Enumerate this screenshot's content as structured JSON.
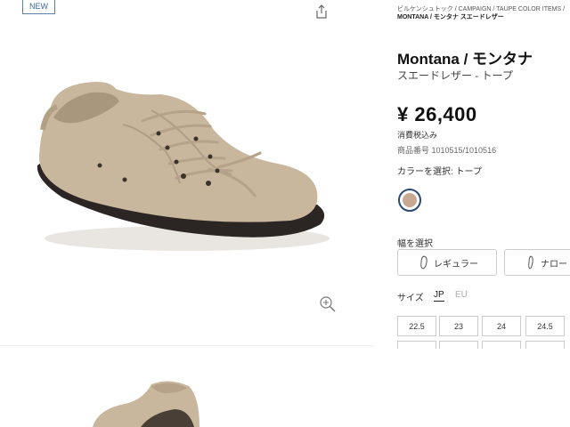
{
  "badge": {
    "new": "NEW"
  },
  "breadcrumb": {
    "line1": "ビルケンシュトック / CAMPAIGN / TAUPE COLOR ITEMS /",
    "line2": "MONTANA / モンタナ スエードレザー"
  },
  "product": {
    "title": "Montana / モンタナ",
    "subtitle": "スエードレザー - トープ",
    "price": "¥ 26,400",
    "tax_note": "消費税込み",
    "item_number": "商品番号 1010515/1010516",
    "color_label": "カラーを選択: トープ",
    "color_swatch": "#c7a893"
  },
  "width": {
    "label": "幅を選択",
    "options": [
      {
        "label": "レギュラー",
        "icon": "foot-regular-icon"
      },
      {
        "label": "ナロー",
        "icon": "foot-narrow-icon"
      }
    ]
  },
  "size": {
    "label": "サイズ",
    "tabs": [
      "JP",
      "EU"
    ],
    "selected_tab": "JP",
    "row1": [
      "22.5",
      "23",
      "24",
      "24.5"
    ]
  },
  "icons": {
    "share": "share-icon",
    "zoom": "zoom-in-icon"
  },
  "colors": {
    "accent": "#2b4a73",
    "badge": "#3d6b9c",
    "shoe_suede": "#c9b79d",
    "sole": "#2b2624"
  }
}
